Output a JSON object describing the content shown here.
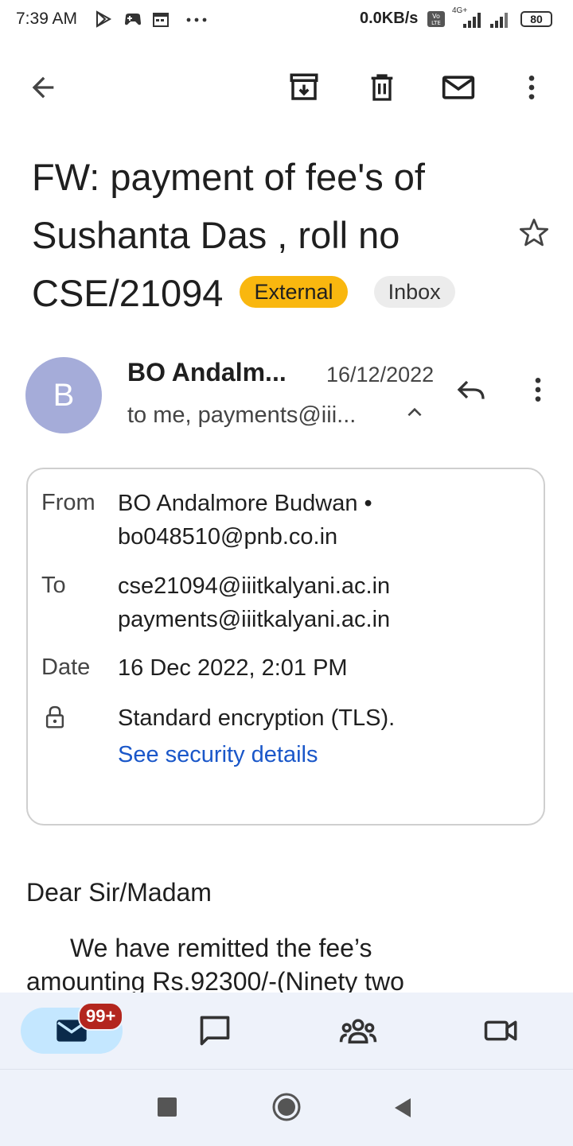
{
  "status_bar": {
    "time": "7:39 AM",
    "speed": "0.0KB/s",
    "network": "4G+",
    "battery": "80"
  },
  "toolbar": {
    "icons": [
      "back-arrow-icon",
      "archive-icon",
      "delete-icon",
      "mark-unread-icon",
      "more-vert-icon"
    ]
  },
  "subject": {
    "line1": "FW: payment of fee's of",
    "line2": "Sushanta Das , roll no",
    "line3": "CSE/21094",
    "chip_external": "External",
    "chip_inbox": "Inbox"
  },
  "sender": {
    "avatar_letter": "B",
    "name": "BO Andalm...",
    "date": "16/12/2022",
    "to": "to me, payments@iii..."
  },
  "details": {
    "from_label": "From",
    "from_name": "BO Andalmore Budwan •",
    "from_email": "bo048510@pnb.co.in",
    "to_label": "To",
    "to_1": "cse21094@iiitkalyani.ac.in",
    "to_2": "payments@iiitkalyani.ac.in",
    "date_label": "Date",
    "date_value": "16 Dec 2022, 2:01 PM",
    "security": "Standard encryption (TLS).",
    "security_link": "See security details"
  },
  "body": {
    "greeting": "Dear Sir/Madam",
    "para_line1": "We have remitted the fee’s",
    "para_line2": "amounting Rs.92300/-(Ninety two"
  },
  "bottom_nav": {
    "mail_badge": "99+",
    "colors": {
      "active_pill": "#c4e7ff",
      "badge": "#b3261e",
      "external_chip": "#f9b70f"
    }
  }
}
